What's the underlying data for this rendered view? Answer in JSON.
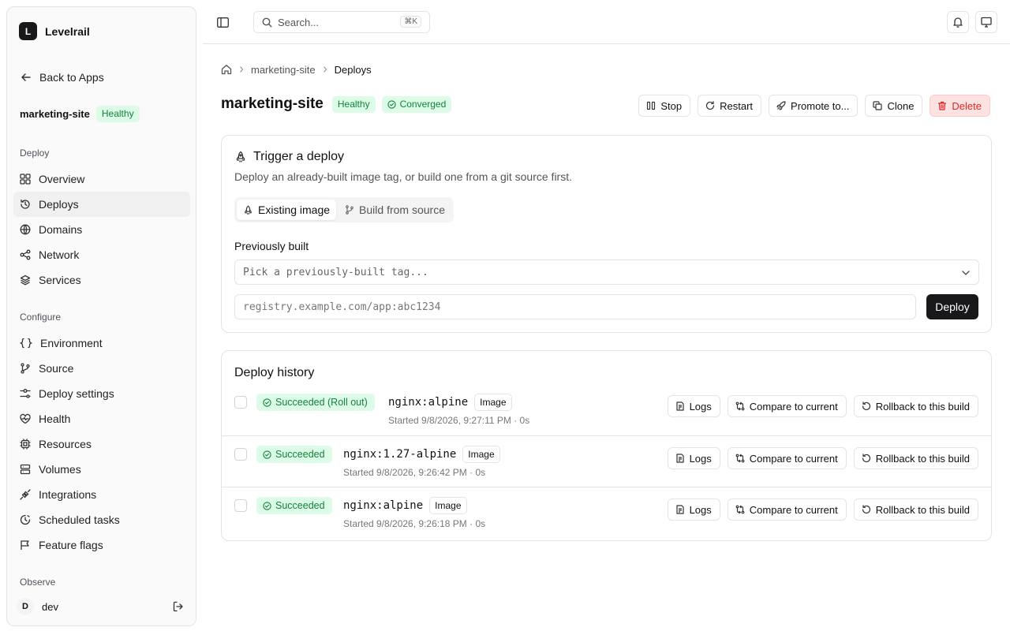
{
  "brand": {
    "logo_letter": "L",
    "name": "Levelrail"
  },
  "sidebar": {
    "back_label": "Back to Apps",
    "app_name": "marketing-site",
    "app_status": "Healthy",
    "sections": {
      "deploy": "Deploy",
      "configure": "Configure",
      "observe": "Observe"
    },
    "deploy_items": [
      "Overview",
      "Deploys",
      "Domains",
      "Network",
      "Services"
    ],
    "configure_items": [
      "Environment",
      "Source",
      "Deploy settings",
      "Health",
      "Resources",
      "Volumes",
      "Integrations",
      "Scheduled tasks",
      "Feature flags"
    ],
    "active_item": "Deploys",
    "user": {
      "initial": "D",
      "name": "dev"
    }
  },
  "topbar": {
    "search_placeholder": "Search...",
    "shortcut": "⌘K"
  },
  "breadcrumb": {
    "app": "marketing-site",
    "current": "Deploys"
  },
  "header": {
    "title": "marketing-site",
    "health_badge": "Healthy",
    "sync_badge": "Converged",
    "actions": {
      "stop": "Stop",
      "restart": "Restart",
      "promote": "Promote to...",
      "clone": "Clone",
      "delete": "Delete"
    }
  },
  "trigger": {
    "title": "Trigger a deploy",
    "description": "Deploy an already-built image tag, or build one from a git source first.",
    "tabs": {
      "existing": "Existing image",
      "source": "Build from source"
    },
    "active_tab": "existing",
    "previously_built_label": "Previously built",
    "select_placeholder": "Pick a previously-built tag...",
    "image_placeholder": "registry.example.com/app:abc1234",
    "deploy_button": "Deploy"
  },
  "history": {
    "title": "Deploy history",
    "row_actions": {
      "logs": "Logs",
      "compare": "Compare to current",
      "rollback": "Rollback to this build"
    },
    "rows": [
      {
        "status": "Succeeded (Roll out)",
        "tag": "nginx:alpine",
        "kind": "Image",
        "meta": "Started 9/8/2026, 9:27:11 PM · 0s"
      },
      {
        "status": "Succeeded",
        "tag": "nginx:1.27-alpine",
        "kind": "Image",
        "meta": "Started 9/8/2026, 9:26:42 PM · 0s"
      },
      {
        "status": "Succeeded",
        "tag": "nginx:alpine",
        "kind": "Image",
        "meta": "Started 9/8/2026, 9:26:18 PM · 0s"
      }
    ]
  },
  "colors": {
    "success_bg": "#dcfce7",
    "success_text": "#15803d",
    "danger_bg": "#fee2e2",
    "danger_text": "#dc2626",
    "primary": "#18181b"
  }
}
